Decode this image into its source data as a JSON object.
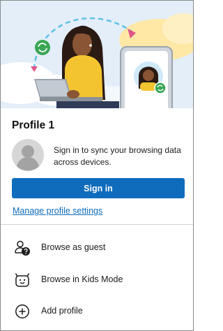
{
  "profile": {
    "name": "Profile 1",
    "sync_message": "Sign in to sync your browsing data across devices.",
    "signin_label": "Sign in",
    "manage_label": "Manage profile settings"
  },
  "menu": [
    {
      "label": "Browse as guest",
      "icon": "guest-icon"
    },
    {
      "label": "Browse in Kids Mode",
      "icon": "kids-mode-icon"
    },
    {
      "label": "Add profile",
      "icon": "add-profile-icon"
    }
  ],
  "colors": {
    "accent": "#0f6cbd",
    "sync_badge": "#3aa655",
    "hero_background": "#e3eef9"
  }
}
